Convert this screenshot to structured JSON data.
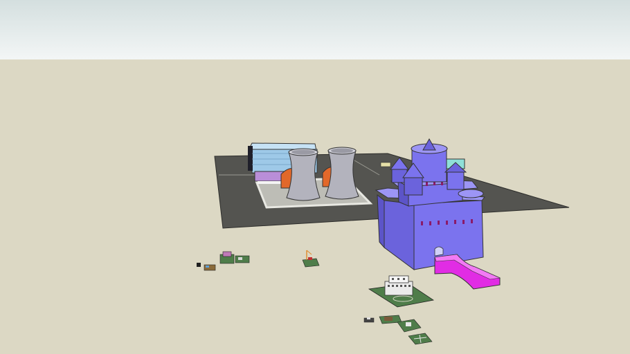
{
  "scene": {
    "sky_top": "#d4dfdf",
    "sky_bottom": "#f3f6f6",
    "ground": "#dcd8c4",
    "road": "#545450",
    "castle": "#7b73ee",
    "castle_dark": "#5c54c8",
    "magenta": "#e12ce4",
    "tower_grey": "#b3b3bd",
    "blue_building": "#9ec9e8",
    "orange": "#e2682a",
    "green_tile": "#4f7d4a"
  }
}
